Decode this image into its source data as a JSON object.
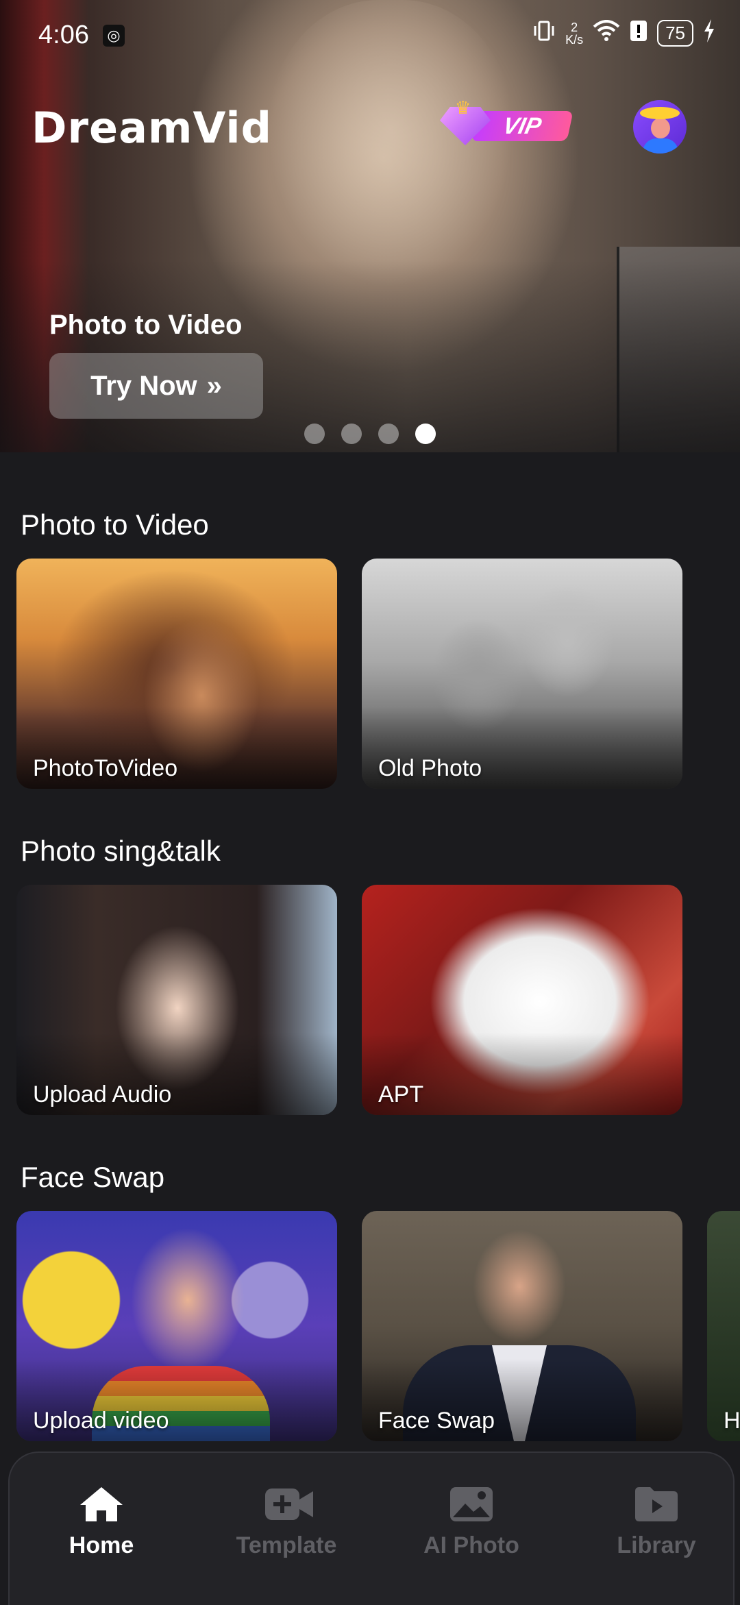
{
  "status_bar": {
    "time": "4:06",
    "net_speed_top": "2",
    "net_speed_bottom": "K/s",
    "battery": "75"
  },
  "header": {
    "logo": "DreamVid",
    "vip_label": "VIP"
  },
  "banner": {
    "title": "Photo to Video",
    "cta_label": "Try Now",
    "cta_icon": "double-chevron-right-icon",
    "page_count": 4,
    "active_page": 4
  },
  "sections": [
    {
      "title": "Photo to Video",
      "cards": [
        "PhotoToVideo",
        "Old Photo"
      ]
    },
    {
      "title": "Photo sing&talk",
      "cards": [
        "Upload Audio",
        "APT"
      ]
    },
    {
      "title": "Face Swap",
      "cards": [
        "Upload video",
        "Face Swap",
        "H"
      ]
    }
  ],
  "bottom_nav": [
    {
      "label": "Home",
      "icon": "home-icon",
      "active": true
    },
    {
      "label": "Template",
      "icon": "video-add-icon",
      "active": false
    },
    {
      "label": "AI Photo",
      "icon": "photo-icon",
      "active": false
    },
    {
      "label": "Library",
      "icon": "folder-play-icon",
      "active": false
    }
  ],
  "colors": {
    "background": "#1b1b1e",
    "nav_background": "#232327",
    "nav_inactive": "#5f5f64",
    "vip_gradient_start": "#c43cff",
    "vip_gradient_end": "#ff5a9c"
  }
}
